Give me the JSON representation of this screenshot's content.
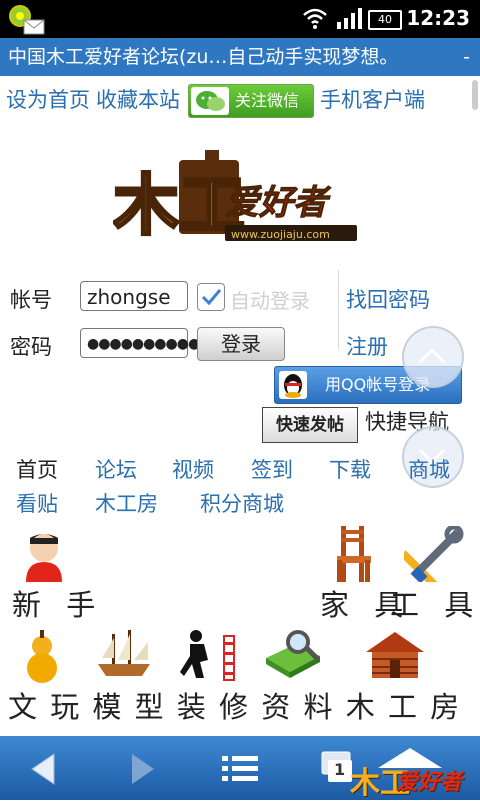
{
  "status_bar": {
    "time": "12:23",
    "battery": "40",
    "icons": [
      "app-notification-icon",
      "mail-icon",
      "wifi-icon",
      "signal-icon",
      "battery-icon"
    ]
  },
  "title_bar": {
    "title": "中国木工爱好者论坛(zu…自己动手实现梦想。",
    "menu": "-"
  },
  "top_links": {
    "set_home": "设为首页",
    "bookmark": "收藏本站",
    "wechat": "关注微信",
    "mobile_client": "手机客户端"
  },
  "logo": {
    "main_char": "木工",
    "name": "爱好者",
    "url": "www.zuojiaju.com"
  },
  "login": {
    "account_label": "帐号",
    "account_value": "zhongse",
    "password_label": "密码",
    "password_value": "●●●●●●●●●●●",
    "auto_login": "自动登录",
    "login_button": "登录",
    "find_password": "找回密码",
    "register": "注册",
    "qq_login": "用QQ帐号登录"
  },
  "fast_post": "快速发帖",
  "quick_nav": "快捷导航",
  "nav_row1": [
    "首页",
    "论坛",
    "视频",
    "签到",
    "下载",
    "商城"
  ],
  "nav_row2": [
    "看贴",
    "木工房",
    "积分商城"
  ],
  "icon_labels": {
    "newbie": "新 手",
    "furniture": "家 具",
    "tools": "工 具",
    "row3": "文 玩 模 型 装 修 资 料 木 工 房"
  },
  "bottom_bar": {
    "tab_count": "1",
    "logo_text": "爱好者"
  },
  "colors": {
    "title_bar": "#2f78c1",
    "link": "#2a6fb0",
    "bottom_bar": "#1c5ba4"
  }
}
